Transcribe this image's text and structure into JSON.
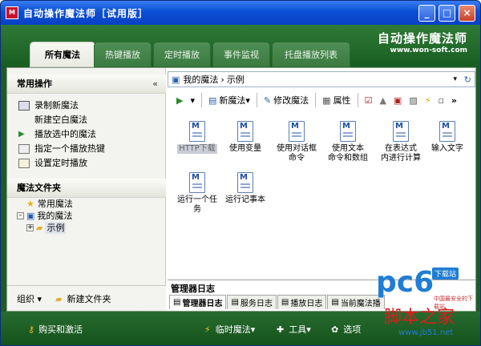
{
  "window": {
    "title": "自动操作魔法师［试用版］",
    "app_icon": "M",
    "minimize": "_",
    "maximize": "□",
    "close": "×"
  },
  "header": {
    "brand": "自动操作魔法师",
    "url": "www.won-soft.com"
  },
  "tabs": [
    {
      "label": "所有魔法",
      "active": true
    },
    {
      "label": "热键播放",
      "active": false
    },
    {
      "label": "定时播放",
      "active": false
    },
    {
      "label": "事件监视",
      "active": false
    },
    {
      "label": "托盘播放列表",
      "active": false
    }
  ],
  "left": {
    "common_title": "常用操作",
    "collapse_glyph": "«",
    "operations": [
      "录制新魔法",
      "新建空白魔法",
      "播放选中的魔法",
      "指定一个播放热键",
      "设置定时播放"
    ],
    "folder_title": "魔法文件夹",
    "tree": [
      "常用魔法",
      "我的魔法",
      "示例"
    ],
    "footer": {
      "organize": "组织",
      "new_folder": "新建文件夹"
    }
  },
  "address": {
    "path_root": "我的魔法",
    "path_sep": "›",
    "path_child": "示例"
  },
  "toolbar": {
    "new_magic": "新魔法",
    "edit_magic": "修改魔法",
    "properties": "属性",
    "more": "»"
  },
  "files": [
    {
      "label": "HTTP下载",
      "selected": true
    },
    {
      "label": "使用变量",
      "selected": false
    },
    {
      "label": "使用对话框\n命令",
      "selected": false
    },
    {
      "label": "使用文本\n命令和数组",
      "selected": false
    },
    {
      "label": "在表达式\n内进行计算",
      "selected": false
    },
    {
      "label": "输入文字",
      "selected": false
    },
    {
      "label": "运行一个任\n务",
      "selected": false
    },
    {
      "label": "运行记事本",
      "selected": false
    }
  ],
  "log": {
    "title": "管理器日志",
    "tabs": [
      "管理器日志",
      "服务日志",
      "播放日志",
      "当前魔法播"
    ]
  },
  "status": {
    "buy": "购买和激活",
    "run_magic": "临时魔法",
    "tools": "工具",
    "options": "选项"
  },
  "watermark": {
    "site": "pc6",
    "badge": "下载站",
    "sub": "中国最安全的下载站",
    "cn": "脚本之家",
    "url": "www.jb51.net"
  },
  "colors": {
    "green": "#1f5c24",
    "title_blue": "#0a4fd6",
    "accent_red": "#d81e1e"
  }
}
